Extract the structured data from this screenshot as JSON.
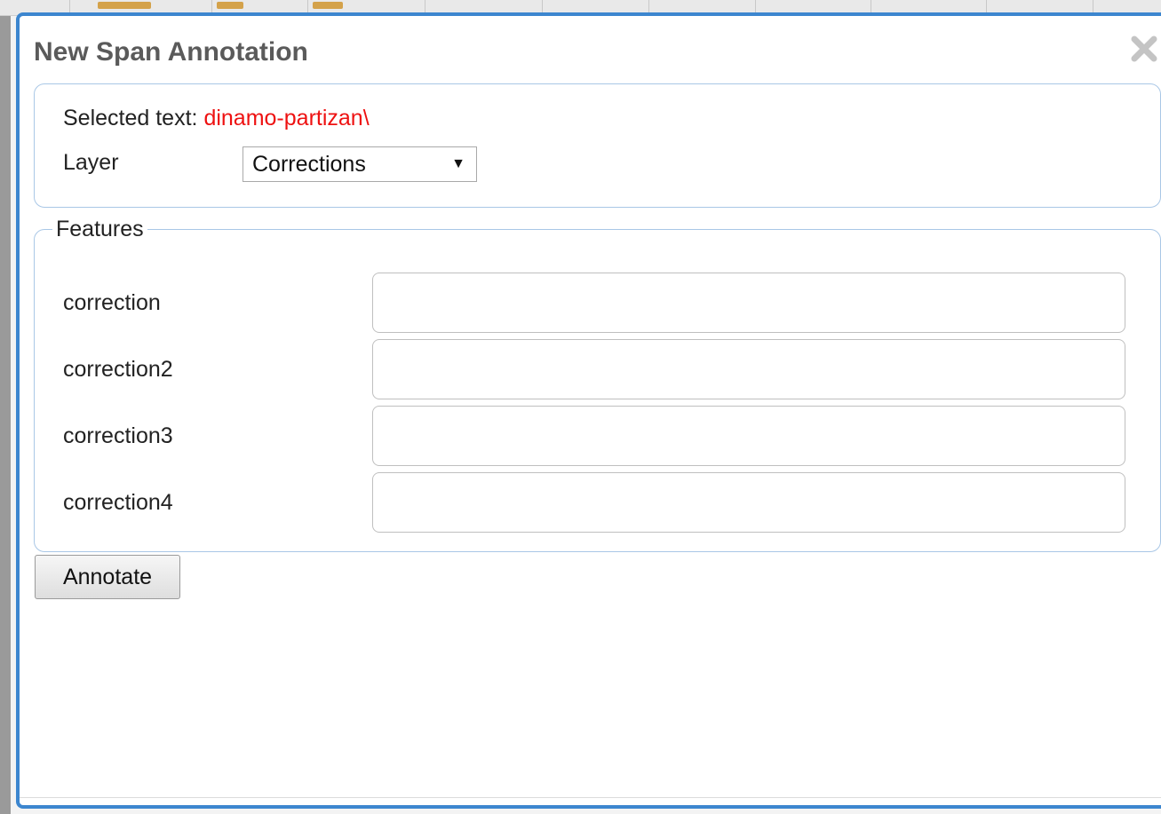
{
  "dialog": {
    "title": "New Span Annotation",
    "close_icon": "close-icon"
  },
  "selection": {
    "label": "Selected text:",
    "value": "dinamo-partizan\\"
  },
  "layer": {
    "label": "Layer",
    "selected": "Corrections",
    "arrow": "▼"
  },
  "features": {
    "legend": "Features",
    "rows": [
      {
        "label": "correction",
        "value": ""
      },
      {
        "label": "correction2",
        "value": ""
      },
      {
        "label": "correction3",
        "value": ""
      },
      {
        "label": "correction4",
        "value": ""
      }
    ]
  },
  "actions": {
    "annotate_label": "Annotate"
  },
  "colors": {
    "dialog_border": "#3c86cf",
    "panel_border": "#a9c7e6",
    "selected_text": "#ee1111",
    "title_text": "#5a5a5a"
  }
}
